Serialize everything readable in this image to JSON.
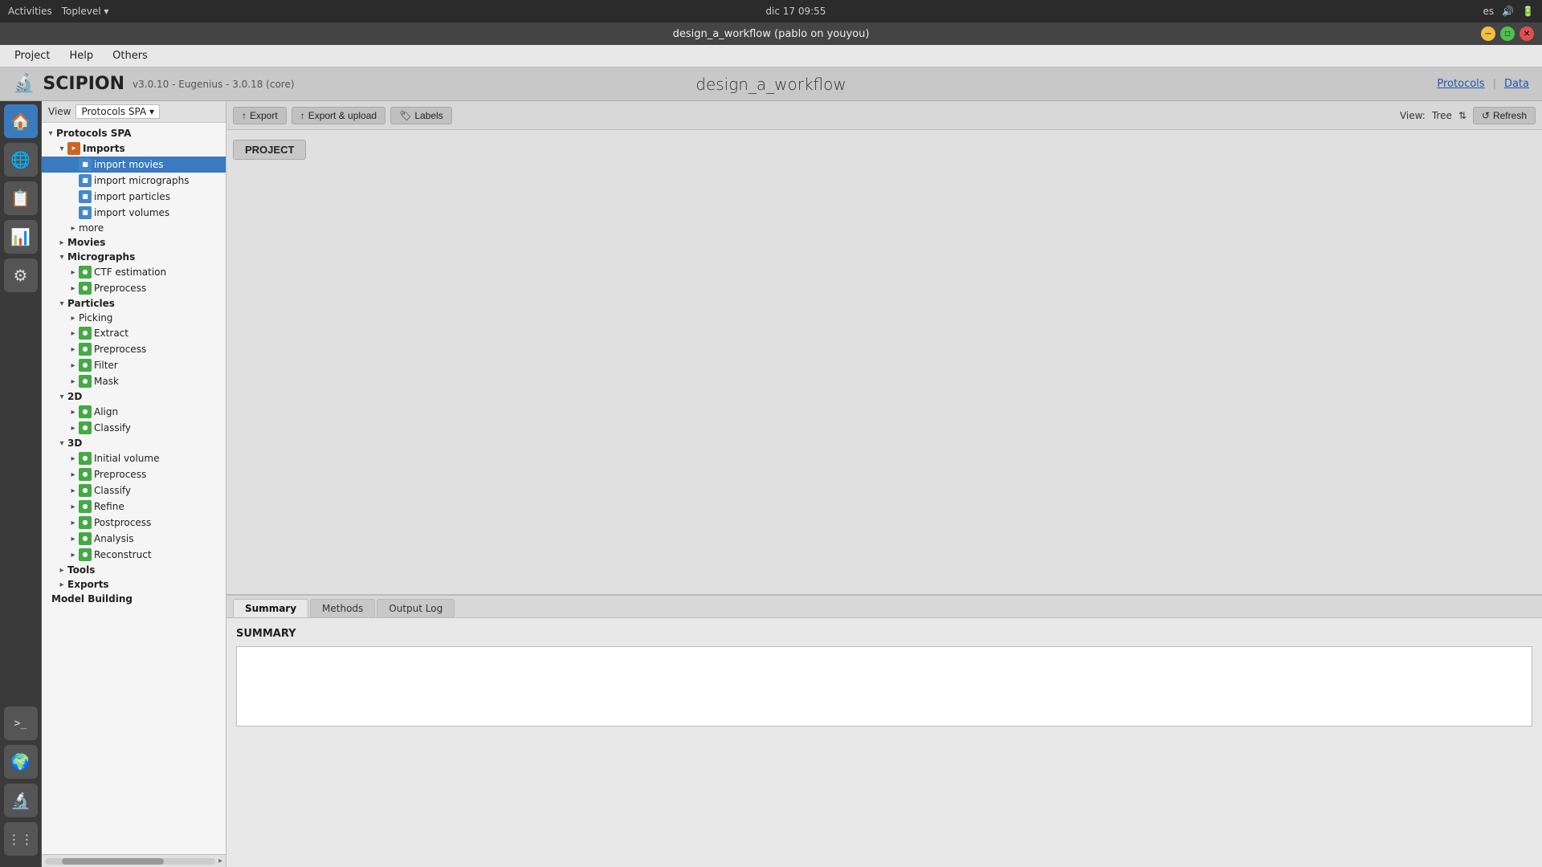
{
  "topbar": {
    "left": "Activities",
    "toplevel": "Toplevel",
    "datetime": "dic 17  09:55",
    "lang": "es"
  },
  "titlebar": {
    "title": "design_a_workflow (pablo on youyou)"
  },
  "menubar": {
    "items": [
      "Project",
      "Help",
      "Others"
    ]
  },
  "header": {
    "logo_text": "SCIPION",
    "version": "v3.0.10 - Eugenius - 3.0.18 (core)",
    "project_name": "design_a_workflow",
    "links": [
      "Protocols",
      "Data"
    ]
  },
  "toolbar": {
    "export_label": "Export",
    "export_upload_label": "Export & upload",
    "labels_label": "Labels",
    "view_label": "View:",
    "view_type": "Tree",
    "refresh_label": "Refresh"
  },
  "workflow": {
    "project_btn": "PROJECT"
  },
  "tree": {
    "root": "Protocols SPA",
    "view_label": "View",
    "view_value": "Protocols SPA",
    "sections": [
      {
        "name": "Imports",
        "expanded": true,
        "items": [
          {
            "label": "import movies",
            "selected": true,
            "icon": "blue"
          },
          {
            "label": "import micrographs",
            "selected": false,
            "icon": "blue"
          },
          {
            "label": "import particles",
            "selected": false,
            "icon": "blue"
          },
          {
            "label": "import volumes",
            "selected": false,
            "icon": "blue"
          },
          {
            "label": "more",
            "selected": false,
            "icon": null
          }
        ]
      },
      {
        "name": "Movies",
        "expanded": false,
        "items": []
      },
      {
        "name": "Micrographs",
        "expanded": true,
        "items": [
          {
            "label": "CTF estimation",
            "selected": false,
            "icon": "green"
          },
          {
            "label": "Preprocess",
            "selected": false,
            "icon": "green"
          }
        ]
      },
      {
        "name": "Particles",
        "expanded": true,
        "items": [
          {
            "label": "Picking",
            "selected": false,
            "icon": null
          },
          {
            "label": "Extract",
            "selected": false,
            "icon": "green"
          },
          {
            "label": "Preprocess",
            "selected": false,
            "icon": "green"
          },
          {
            "label": "Filter",
            "selected": false,
            "icon": "green"
          },
          {
            "label": "Mask",
            "selected": false,
            "icon": "green"
          }
        ]
      },
      {
        "name": "2D",
        "expanded": true,
        "items": [
          {
            "label": "Align",
            "selected": false,
            "icon": "green"
          },
          {
            "label": "Classify",
            "selected": false,
            "icon": "green"
          }
        ]
      },
      {
        "name": "3D",
        "expanded": true,
        "items": [
          {
            "label": "Initial volume",
            "selected": false,
            "icon": "green"
          },
          {
            "label": "Preprocess",
            "selected": false,
            "icon": "green"
          },
          {
            "label": "Classify",
            "selected": false,
            "icon": "green"
          },
          {
            "label": "Refine",
            "selected": false,
            "icon": "green"
          },
          {
            "label": "Postprocess",
            "selected": false,
            "icon": "green"
          },
          {
            "label": "Analysis",
            "selected": false,
            "icon": "green"
          },
          {
            "label": "Reconstruct",
            "selected": false,
            "icon": "green"
          }
        ]
      },
      {
        "name": "Tools",
        "expanded": false,
        "items": []
      },
      {
        "name": "Exports",
        "expanded": false,
        "items": []
      },
      {
        "name": "Model Building",
        "expanded": false,
        "items": []
      }
    ]
  },
  "bottom": {
    "tabs": [
      "Summary",
      "Methods",
      "Output Log"
    ],
    "active_tab": "Summary",
    "summary_label": "SUMMARY",
    "summary_content": ""
  },
  "sidebar_icons": [
    {
      "name": "home-icon",
      "symbol": "🏠"
    },
    {
      "name": "browser-icon",
      "symbol": "🌐"
    },
    {
      "name": "files-icon",
      "symbol": "📋"
    },
    {
      "name": "table-icon",
      "symbol": "📊"
    },
    {
      "name": "settings-icon",
      "symbol": "⚙"
    },
    {
      "name": "terminal-icon",
      "symbol": ">_"
    },
    {
      "name": "network-icon",
      "symbol": "🌍"
    },
    {
      "name": "scipion-icon",
      "symbol": "🔬"
    },
    {
      "name": "more-icon",
      "symbol": "⋮"
    }
  ]
}
